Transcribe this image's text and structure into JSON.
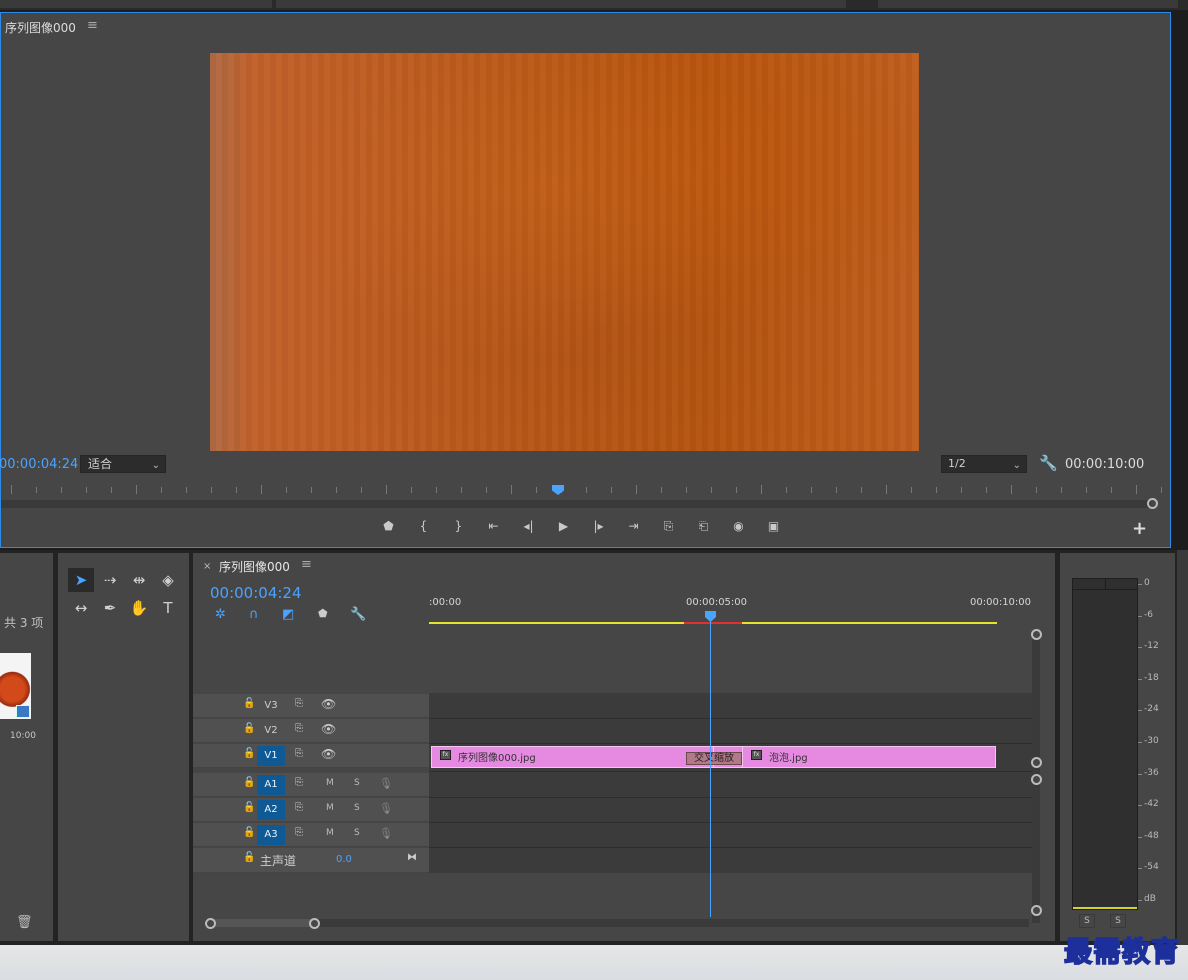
{
  "program_monitor": {
    "title": "序列图像000",
    "menu_icon": "≡",
    "playhead_timecode": "00:00:04:24",
    "fit_select": "适合",
    "resolution_select": "1/2",
    "duration": "00:00:10:00",
    "playhead_position": 0.48,
    "transport_icons": [
      "marker-icon",
      "mark-in-icon",
      "mark-out-icon",
      "go-to-in-icon",
      "step-back-icon",
      "play-icon",
      "step-forward-icon",
      "go-to-out-icon",
      "lift-icon",
      "extract-icon",
      "export-frame-icon",
      "button-editor-icon"
    ],
    "transport_glyphs": [
      "⬟",
      "{",
      "}",
      "⇤",
      "◂|",
      "▶",
      "|▸",
      "⇥",
      "⎘",
      "⎗",
      "◉",
      "▣"
    ]
  },
  "project_panel": {
    "item_count": "共 3 项",
    "thumbnail_duration": "10:00"
  },
  "tools": {
    "icons": [
      "selection-tool-icon",
      "track-select-tool-icon",
      "ripple-edit-tool-icon",
      "razor-tool-icon",
      "slip-tool-icon",
      "pen-tool-icon",
      "hand-tool-icon",
      "type-tool-icon"
    ],
    "glyphs": [
      "➤",
      "⇢",
      "⇹",
      "◈",
      "↔",
      "✒",
      "✋",
      "T"
    ],
    "active_index": 0
  },
  "timeline": {
    "tab_close": "×",
    "title": "序列图像000",
    "menu_icon": "≡",
    "timecode": "00:00:04:24",
    "ruler_labels": [
      ":00:00",
      "00:00:05:00",
      "00:00:10:00"
    ],
    "video_tracks": [
      {
        "name": "V3",
        "targeted": false
      },
      {
        "name": "V2",
        "targeted": false
      },
      {
        "name": "V1",
        "targeted": true
      }
    ],
    "audio_tracks": [
      {
        "name": "A1",
        "targeted": true,
        "mute": "M",
        "solo": "S"
      },
      {
        "name": "A2",
        "targeted": true,
        "mute": "M",
        "solo": "S"
      },
      {
        "name": "A3",
        "targeted": true,
        "mute": "M",
        "solo": "S"
      }
    ],
    "master": {
      "label": "主声道",
      "value": "0.0"
    },
    "clips": [
      {
        "name": "序列图像000.jpg",
        "fx": "fx"
      },
      {
        "name": "泡泡.jpg",
        "fx": "fx"
      }
    ],
    "transition": "交叉缩放"
  },
  "audio_meter": {
    "db_labels": [
      "0",
      "-6",
      "-12",
      "-18",
      "-24",
      "-30",
      "-36",
      "-42",
      "-48",
      "-54",
      "dB"
    ],
    "solo_buttons": [
      "S",
      "S"
    ]
  },
  "watermark": "最需教育"
}
